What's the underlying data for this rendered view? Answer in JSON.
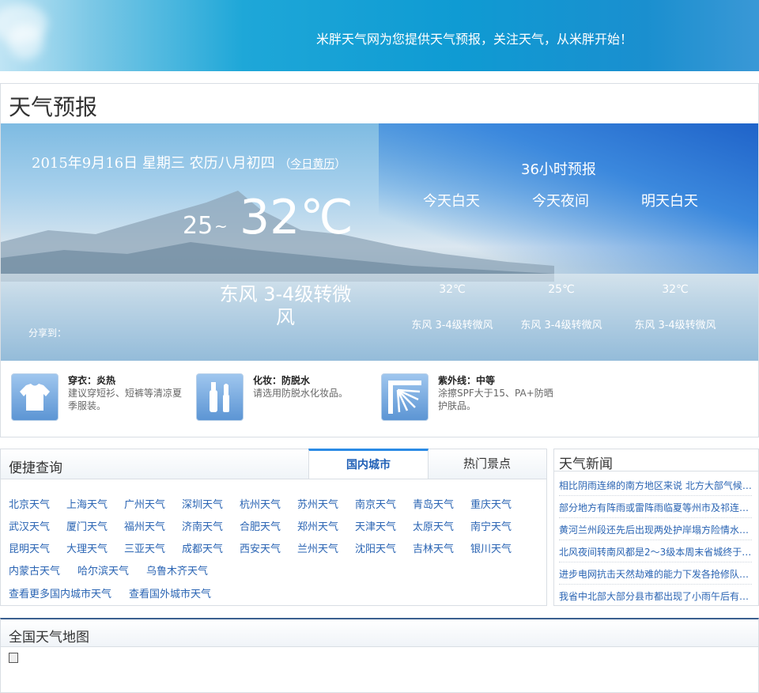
{
  "banner": {
    "slogan": "米胖天气网为您提供天气预报，关注天气，从米胖开始！"
  },
  "forecast": {
    "title": "天气预报",
    "date_line": "2015年9月16日 星期三 农历八月初四",
    "almanac_link": "今日黄历",
    "paren_open": "（",
    "paren_close": "）",
    "temp_low": "25",
    "temp_tilde": "~",
    "temp_high": "32℃",
    "wind": "东风 3-4级转微风",
    "share_label": "分享到：",
    "h36_label": "36小时预报",
    "periods": [
      {
        "label": "今天白天",
        "temp": "32℃",
        "wind": "东风 3-4级转微风"
      },
      {
        "label": "今天夜间",
        "temp": "25℃",
        "wind": "东风 3-4级转微风"
      },
      {
        "label": "明天白天",
        "temp": "32℃",
        "wind": "东风 3-4级转微风"
      }
    ],
    "tips": [
      {
        "title": "穿衣：炎热",
        "desc": "建议穿短衫、短裤等清凉夏季服装。",
        "icon": "shirt-icon"
      },
      {
        "title": "化妆：防脱水",
        "desc": "请选用防脱水化妆品。",
        "icon": "cosmetics-icon"
      },
      {
        "title": "紫外线：中等",
        "desc": "涂擦SPF大于15、PA+防晒护肤品。",
        "icon": "sun-uv-icon"
      }
    ]
  },
  "quick": {
    "title": "便捷查询",
    "tabs": [
      {
        "label": "国内城市"
      },
      {
        "label": "热门景点"
      }
    ],
    "cities": [
      [
        "北京天气",
        "上海天气",
        "广州天气",
        "深圳天气",
        "杭州天气",
        "苏州天气",
        "南京天气",
        "青岛天气",
        "重庆天气"
      ],
      [
        "武汉天气",
        "厦门天气",
        "福州天气",
        "济南天气",
        "合肥天气",
        "郑州天气",
        "天津天气",
        "太原天气",
        "南宁天气"
      ],
      [
        "昆明天气",
        "大理天气",
        "三亚天气",
        "成都天气",
        "西安天气",
        "兰州天气",
        "沈阳天气",
        "吉林天气",
        "银川天气"
      ],
      [
        "内蒙古天气",
        "哈尔滨天气",
        "乌鲁木齐天气"
      ],
      [
        "查看更多国内城市天气",
        "查看国外城市天气"
      ]
    ]
  },
  "news": {
    "title": "天气新闻",
    "items": [
      "相比阴雨连绵的南方地区来说 北方大部气候…",
      "部分地方有阵雨或雷阵雨临夏等州市及祁连…",
      "黄河兰州段还先后出现两处护岸塌方险情水…",
      "北风夜间转南风都是2～3级本周末省城终于…",
      "进步电网抗击天然劫难的能力下发各抢修队…",
      "我省中北部大部分县市都出现了小雨午后有…"
    ]
  },
  "map": {
    "title": "全国天气地图"
  }
}
